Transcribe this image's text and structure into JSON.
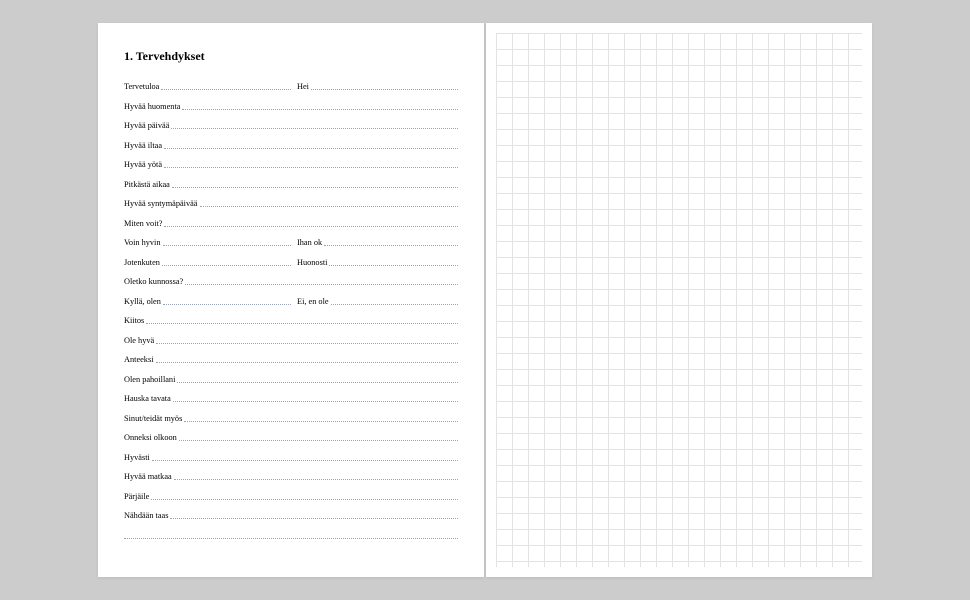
{
  "section": {
    "title": "1. Tervehdykset"
  },
  "rows": [
    {
      "type": "pair",
      "left": "Tervetuloa",
      "right": "Hei"
    },
    {
      "type": "single",
      "text": "Hyvää huomenta"
    },
    {
      "type": "single",
      "text": "Hyvää päivää"
    },
    {
      "type": "single",
      "text": "Hyvää iltaa"
    },
    {
      "type": "single",
      "text": "Hyvää yötä"
    },
    {
      "type": "single",
      "text": "Pitkästä aikaa"
    },
    {
      "type": "single",
      "text": "Hyvää syntymäpäivää"
    },
    {
      "type": "single",
      "text": "Miten voit?"
    },
    {
      "type": "pair",
      "left": "Voin hyvin",
      "right": "Ihan ok"
    },
    {
      "type": "pair",
      "left": "Jotenkuten",
      "right": "Huonosti"
    },
    {
      "type": "single",
      "text": "Oletko kunnossa?"
    },
    {
      "type": "pair",
      "left": "Kyllä, olen",
      "right": "Ei, en ole"
    },
    {
      "type": "single",
      "text": "Kiitos"
    },
    {
      "type": "single",
      "text": "Ole hyvä"
    },
    {
      "type": "single",
      "text": "Anteeksi"
    },
    {
      "type": "single",
      "text": "Olen pahoillani"
    },
    {
      "type": "single",
      "text": "Hauska tavata"
    },
    {
      "type": "single",
      "text": "Sinut/teidät myös"
    },
    {
      "type": "single",
      "text": "Onneksi olkoon"
    },
    {
      "type": "single",
      "text": "Hyvästi"
    },
    {
      "type": "single",
      "text": "Hyvää matkaa"
    },
    {
      "type": "single",
      "text": "Pärjäile"
    },
    {
      "type": "single",
      "text": "Nähdään taas"
    },
    {
      "type": "blank"
    }
  ]
}
